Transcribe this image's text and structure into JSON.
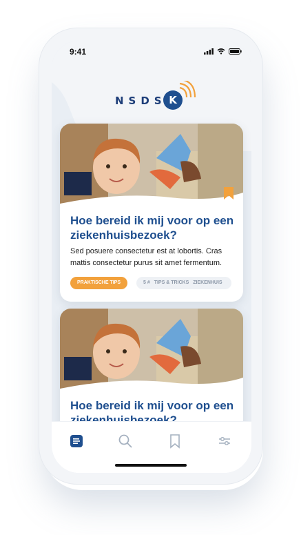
{
  "status_bar": {
    "time": "9:41"
  },
  "logo": {
    "text": "NSDS",
    "letter": "K"
  },
  "colors": {
    "brand_blue": "#1f4f8f",
    "accent_orange": "#f2a13c",
    "background": "#e9eef4"
  },
  "cards": [
    {
      "title": "Hoe bereid ik mij voor op een ziekenhuisbezoek?",
      "description": "Sed posuere consectetur est at lobortis. Cras mattis consectetur purus sit amet fermentum.",
      "primary_tag": "PRAKTISCHE TIPS",
      "secondary_tags": [
        "5 #",
        "TIPS & TRICKS",
        "ZIEKENHUIS"
      ],
      "bookmarked": true
    },
    {
      "title": "Hoe bereid ik mij voor op een ziekenhuisbezoek?"
    }
  ],
  "tab_bar": {
    "items": [
      {
        "icon": "articles-icon",
        "active": true
      },
      {
        "icon": "search-icon",
        "active": false
      },
      {
        "icon": "bookmark-icon",
        "active": false
      },
      {
        "icon": "filter-icon",
        "active": false
      }
    ]
  }
}
